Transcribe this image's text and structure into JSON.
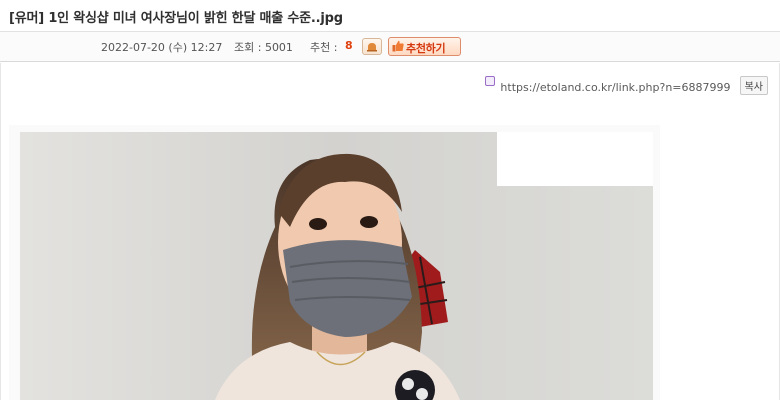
{
  "post": {
    "title": "[유머] 1인 왁싱샵 미녀 여사장님이 밝힌 한달 매출 수준..jpg",
    "date": "2022-07-20 (수) 12:27",
    "views": "조회 : 5001",
    "recommend_label": "추천 :",
    "recommend_count": "8",
    "recommend_button": "추천하기"
  },
  "link": {
    "url": "https://etoland.co.kr/link.php?n=6887999",
    "copy_label": "복사"
  },
  "colors": {
    "accent": "#e0410f",
    "title_text": "#2f2f2f"
  }
}
